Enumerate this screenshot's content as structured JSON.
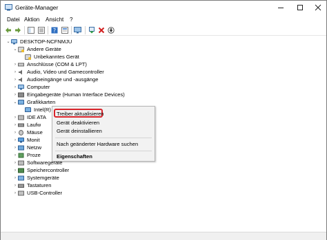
{
  "window": {
    "title": "Geräte-Manager"
  },
  "menu": {
    "items": [
      "Datei",
      "Aktion",
      "Ansicht",
      "?"
    ]
  },
  "tree": {
    "root": "DESKTOP-NCFNMJU",
    "andere": "Andere Geräte",
    "unbekannt": "Unbekanntes Gerät",
    "anschluesse": "Anschlüsse (COM & LPT)",
    "audio": "Audio, Video und Gamecontroller",
    "audioio": "Audioeingänge und -ausgänge",
    "computer": "Computer",
    "hid": "Eingabegeräte (Human Interface Devices)",
    "grafik": "Grafikkarten",
    "grafik_child": "Intel(R) HD Graphics 4600",
    "ide": "IDE ATA",
    "laufwerke": "Laufw",
    "maeuse": "Mäuse",
    "monitore": "Monit",
    "netzwerk": "Netzw",
    "prozessoren": "Proze",
    "software": "Softwaregeräte",
    "speicher": "Speichercontroller",
    "system": "Systemgeräte",
    "tastaturen": "Tastaturen",
    "usb": "USB-Controller"
  },
  "context_menu": {
    "update": "Treiber aktualisieren",
    "disable": "Gerät deaktivieren",
    "uninstall": "Gerät deinstallieren",
    "scan": "Nach geänderter Hardware suchen",
    "properties": "Eigenschaften"
  },
  "colors": {
    "highlight_border": "#d8232a",
    "accent": "#1e6fd9"
  }
}
